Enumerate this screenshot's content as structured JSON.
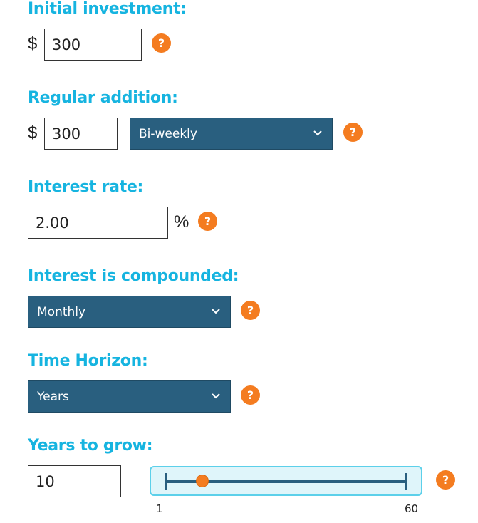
{
  "colors": {
    "heading": "#16b4e0",
    "select_bg": "#295f7f",
    "help_bg": "#f47c20",
    "slider_bg": "#dff5fa",
    "slider_border": "#5cd0ea"
  },
  "initial_investment": {
    "label": "Initial investment:",
    "currency": "$",
    "value": "300",
    "help": "?"
  },
  "regular_addition": {
    "label": "Regular addition:",
    "currency": "$",
    "value": "300",
    "frequency": "Bi-weekly",
    "help": "?"
  },
  "interest_rate": {
    "label": "Interest rate:",
    "value": "2.00",
    "unit": "%",
    "help": "?"
  },
  "compounding": {
    "label": "Interest is compounded:",
    "value": "Monthly",
    "help": "?"
  },
  "time_horizon": {
    "label": "Time Horizon:",
    "value": "Years",
    "help": "?"
  },
  "years_to_grow": {
    "label": "Years to grow:",
    "value": "10",
    "help": "?",
    "slider": {
      "min": 1,
      "max": 60,
      "value": 10,
      "min_label": "1",
      "max_label": "60"
    }
  },
  "icons": {
    "dropdown": "chevron-down-icon",
    "help": "question-mark-icon"
  }
}
